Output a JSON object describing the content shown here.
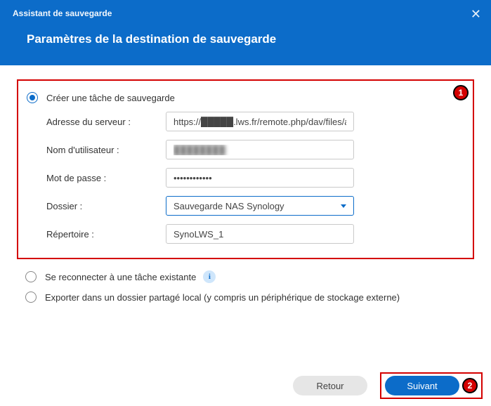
{
  "header": {
    "breadcrumb": "Assistant de sauvegarde",
    "title": "Paramètres de la destination de sauvegarde"
  },
  "options": {
    "create_label": "Créer une tâche de sauvegarde",
    "reconnect_label": "Se reconnecter à une tâche existante",
    "export_label": "Exporter dans un dossier partagé local (y compris un périphérique de stockage externe)"
  },
  "form": {
    "server_label": "Adresse du serveur :",
    "server_value": "https://█████.lws.fr/remote.php/dav/files/aur",
    "user_label": "Nom d'utilisateur :",
    "user_value": "████████",
    "pass_label": "Mot de passe :",
    "pass_value": "••••••••••••",
    "folder_label": "Dossier :",
    "folder_value": "Sauvegarde NAS Synology",
    "dir_label": "Répertoire :",
    "dir_value": "SynoLWS_1"
  },
  "badges": {
    "one": "1",
    "two": "2"
  },
  "footer": {
    "back": "Retour",
    "next": "Suivant"
  },
  "icons": {
    "info": "i",
    "close": "✕"
  }
}
